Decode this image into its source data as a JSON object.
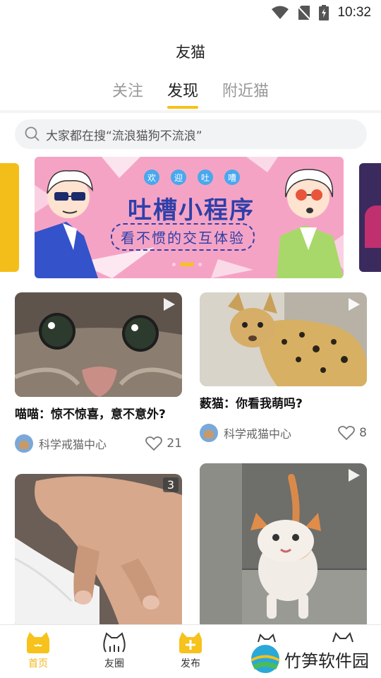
{
  "status_bar": {
    "time": "10:32"
  },
  "app": {
    "title": "友猫"
  },
  "tabs": [
    {
      "label": "关注",
      "active": false
    },
    {
      "label": "发现",
      "active": true
    },
    {
      "label": "附近猫",
      "active": false
    }
  ],
  "search": {
    "placeholder": "大家都在搜“流浪猫狗不流浪”"
  },
  "banner": {
    "badges": [
      "欢",
      "迎",
      "吐",
      "嘈"
    ],
    "title": "吐槽小程序",
    "subtitle": "看不惯的交互体验",
    "page_count": 3,
    "active_page": 2
  },
  "feed": [
    {
      "caption": "喵喵：惊不惊喜，意不意外?",
      "author": "科学戒猫中心",
      "likes": "21",
      "type": "video"
    },
    {
      "caption": "薮猫：你看我萌吗?",
      "author": "科学戒猫中心",
      "likes": "8",
      "type": "video"
    },
    {
      "caption": "",
      "author": "",
      "likes": "",
      "type": "gallery",
      "image_count": "3"
    },
    {
      "caption": "",
      "author": "",
      "likes": "",
      "type": "video"
    }
  ],
  "bottom_nav": [
    {
      "label": "首页",
      "icon": "home-cat-icon",
      "active": true
    },
    {
      "label": "友圈",
      "icon": "friends-cat-icon",
      "active": false
    },
    {
      "label": "发布",
      "icon": "publish-plus-icon",
      "active": false
    },
    {
      "label": "",
      "icon": "message-cat-icon",
      "active": false
    },
    {
      "label": "",
      "icon": "profile-cat-icon",
      "active": false
    }
  ],
  "watermark": {
    "text": "竹笋软件园"
  },
  "colors": {
    "accent": "#f6c21b",
    "banner_bg": "#f5a3c5",
    "banner_text": "#2f3fa8"
  }
}
